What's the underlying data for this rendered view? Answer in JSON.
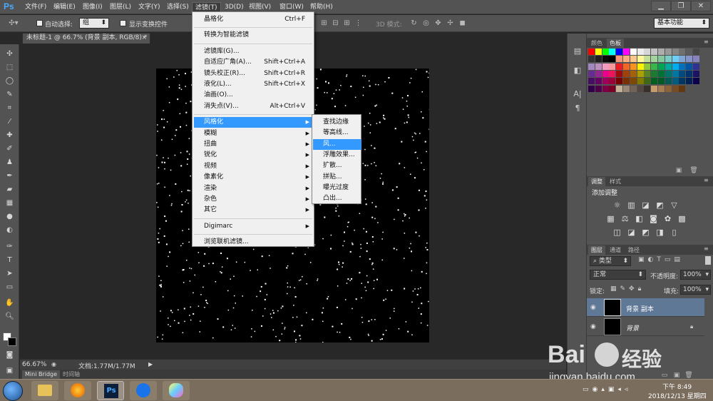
{
  "app": {
    "logo": "Ps"
  },
  "menubar": {
    "items": [
      "文件(F)",
      "编辑(E)",
      "图像(I)",
      "图层(L)",
      "文字(Y)",
      "选择(S)",
      "滤镜(T)",
      "3D(D)",
      "视图(V)",
      "窗口(W)",
      "帮助(H)"
    ],
    "active": "滤镜(T)",
    "window_buttons": [
      "▁",
      "❐",
      "✕"
    ]
  },
  "options_bar": {
    "auto_select_label": "自动选择:",
    "auto_select_value": "组",
    "show_transform_label": "显示变换控件",
    "mode_3d_label": "3D 模式:",
    "workspace_value": "基本功能"
  },
  "document": {
    "tab_title": "未标题-1 @ 66.7% (背景 副本, RGB/8) *",
    "zoom": "66.67%",
    "doc_size": "文档:1.77M/1.77M"
  },
  "bottom_tabs": [
    "Mini Bridge",
    "时间轴"
  ],
  "filter_menu": {
    "items": [
      {
        "label": "晶格化",
        "shortcut": "Ctrl+F"
      },
      {
        "sep": true
      },
      {
        "label": "转换为智能滤镜"
      },
      {
        "sep": true
      },
      {
        "label": "滤镜库(G)..."
      },
      {
        "label": "自适应广角(A)...",
        "shortcut": "Shift+Ctrl+A"
      },
      {
        "label": "镜头校正(R)...",
        "shortcut": "Shift+Ctrl+R"
      },
      {
        "label": "液化(L)...",
        "shortcut": "Shift+Ctrl+X"
      },
      {
        "label": "油画(O)..."
      },
      {
        "label": "消失点(V)...",
        "shortcut": "Alt+Ctrl+V"
      },
      {
        "sep": true
      },
      {
        "label": "风格化",
        "submenu": true,
        "highlight": true
      },
      {
        "label": "模糊",
        "submenu": true
      },
      {
        "label": "扭曲",
        "submenu": true
      },
      {
        "label": "锐化",
        "submenu": true
      },
      {
        "label": "视频",
        "submenu": true
      },
      {
        "label": "像素化",
        "submenu": true
      },
      {
        "label": "渲染",
        "submenu": true
      },
      {
        "label": "杂色",
        "submenu": true
      },
      {
        "label": "其它",
        "submenu": true
      },
      {
        "sep": true
      },
      {
        "label": "Digimarc",
        "submenu": true
      },
      {
        "sep": true
      },
      {
        "label": "浏览联机滤镜..."
      }
    ]
  },
  "stylize_submenu": {
    "items": [
      "查找边缘",
      "等高线...",
      "风...",
      "浮雕效果...",
      "扩散...",
      "拼贴...",
      "曝光过度",
      "凸出..."
    ],
    "highlighted": "风..."
  },
  "swatches_panel": {
    "tabs": [
      "颜色",
      "色板"
    ],
    "active": "色板"
  },
  "adjustments_panel": {
    "tabs": [
      "调整",
      "样式"
    ],
    "active": "调整",
    "heading": "添加调整"
  },
  "layers_panel": {
    "tabs": [
      "图层",
      "通道",
      "路径"
    ],
    "active": "图层",
    "filter_label": "类型",
    "blend_mode": "正常",
    "opacity_label": "不透明度:",
    "opacity_value": "100%",
    "lock_label": "锁定:",
    "fill_label": "填充:",
    "fill_value": "100%",
    "layers": [
      {
        "name": "背景 副本",
        "selected": true
      },
      {
        "name": "背景",
        "locked": true
      }
    ]
  },
  "taskbar": {
    "time": "下午 8:49",
    "date": "2018/12/13 星期四"
  },
  "watermark": {
    "brand": "Bai",
    "brand2": "经验",
    "url": "jingyan.baidu.com"
  },
  "colors": {
    "menu_highlight": "#3399ff",
    "ps_blue": "#4ca9ff",
    "panel_bg": "#535353"
  }
}
